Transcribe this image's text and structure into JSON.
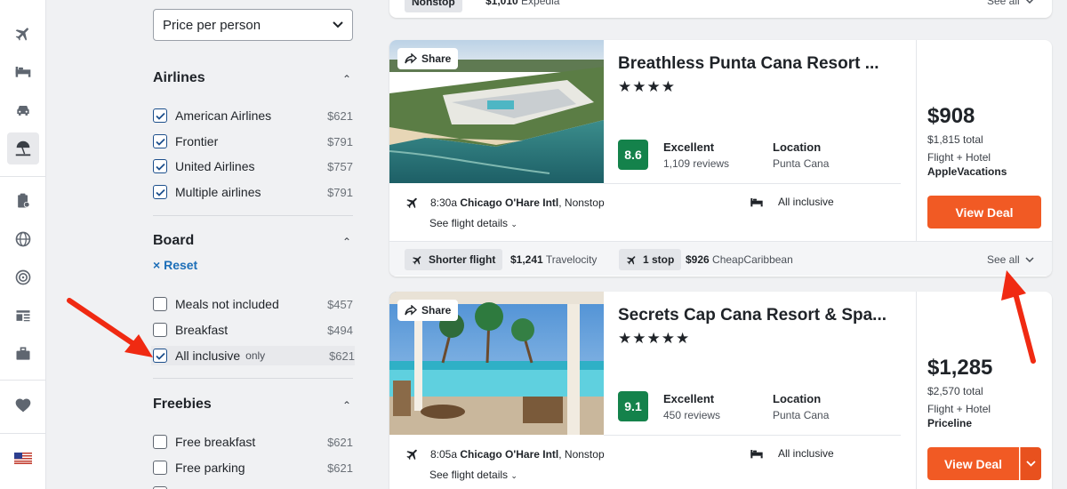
{
  "rail": {
    "items": [
      {
        "icon": "plane-icon",
        "active": false
      },
      {
        "icon": "bed-icon",
        "active": false
      },
      {
        "icon": "car-icon",
        "active": false
      },
      {
        "icon": "beach-umbrella-icon",
        "active": true
      },
      {
        "icon": "clipboard-icon",
        "active": false
      },
      {
        "icon": "globe-icon",
        "active": false
      },
      {
        "icon": "target-icon",
        "active": false
      },
      {
        "icon": "news-icon",
        "active": false
      },
      {
        "icon": "briefcase-icon",
        "active": false
      },
      {
        "icon": "heart-icon",
        "active": false
      },
      {
        "icon": "us-flag-icon",
        "active": false
      }
    ]
  },
  "filters": {
    "sort_select": "Price per person",
    "airlines": {
      "title": "Airlines",
      "items": [
        {
          "label": "American Airlines",
          "price": "$621",
          "checked": true
        },
        {
          "label": "Frontier",
          "price": "$791",
          "checked": true
        },
        {
          "label": "United Airlines",
          "price": "$757",
          "checked": true
        },
        {
          "label": "Multiple airlines",
          "price": "$791",
          "checked": true
        }
      ]
    },
    "board": {
      "title": "Board",
      "reset": "Reset",
      "items": [
        {
          "label": "Meals not included",
          "price": "$457",
          "checked": false
        },
        {
          "label": "Breakfast",
          "price": "$494",
          "checked": false
        },
        {
          "label": "All inclusive",
          "only": "only",
          "price": "$621",
          "checked": true
        }
      ]
    },
    "freebies": {
      "title": "Freebies",
      "items": [
        {
          "label": "Free breakfast",
          "price": "$621",
          "checked": false
        },
        {
          "label": "Free parking",
          "price": "$621",
          "checked": false
        }
      ]
    }
  },
  "top_strip": {
    "chip": "Nonstop",
    "price": "$1,010",
    "provider": "Expedia",
    "see_all": "See all"
  },
  "results": [
    {
      "share": "Share",
      "name": "Breathless Punta Cana Resort ...",
      "stars": "★★★★",
      "score": "8.6",
      "rating_label": "Excellent",
      "reviews": "1,109 reviews",
      "location_label": "Location",
      "location": "Punta Cana",
      "flight_time": "8:30a",
      "airport": "Chicago O'Hare Intl",
      "stops": ", Nonstop",
      "see_flight": "See flight details",
      "board": "All inclusive",
      "price": "$908",
      "total": "$1,815 total",
      "package": "Flight + Hotel",
      "provider": "AppleVacations",
      "deal": "View Deal",
      "footer": {
        "chip1": "Shorter flight",
        "price1": "$1,241",
        "prov1": "Travelocity",
        "chip2": "1 stop",
        "price2": "$926",
        "prov2": "CheapCaribbean",
        "see_all": "See all"
      }
    },
    {
      "share": "Share",
      "name": "Secrets Cap Cana Resort & Spa...",
      "stars": "★★★★★",
      "score": "9.1",
      "rating_label": "Excellent",
      "reviews": "450 reviews",
      "location_label": "Location",
      "location": "Punta Cana",
      "flight_time": "8:05a",
      "airport": "Chicago O'Hare Intl",
      "stops": ", Nonstop",
      "see_flight": "See flight details",
      "board": "All inclusive",
      "price": "$1,285",
      "total": "$2,570 total",
      "package": "Flight + Hotel",
      "provider": "Priceline",
      "deal": "View Deal"
    }
  ],
  "colors": {
    "accent_orange": "#f15a24",
    "score_green": "#14824b",
    "annotation_red": "#f02a12",
    "link_blue": "#1d6fb8"
  }
}
